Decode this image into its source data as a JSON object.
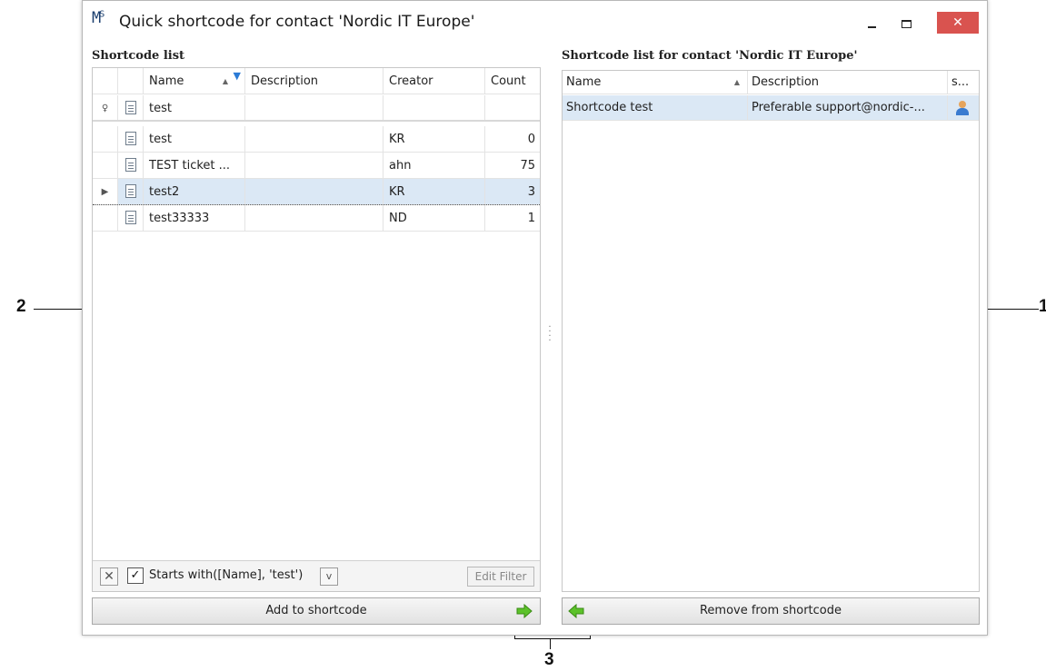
{
  "callouts": {
    "left": "2",
    "right": "1",
    "bottom": "3"
  },
  "window": {
    "logo": "M",
    "logo_sup": "S",
    "title": "Quick shortcode for contact 'Nordic IT Europe'",
    "close_label": "✕"
  },
  "left_panel": {
    "title": "Shortcode list",
    "columns": {
      "name": "Name",
      "description": "Description",
      "creator": "Creator",
      "count": "Count"
    },
    "filter_row": {
      "name": "test"
    },
    "rows": [
      {
        "name": "test",
        "description": "",
        "creator": "KR",
        "count": "0"
      },
      {
        "name": "TEST ticket ...",
        "description": "",
        "creator": "ahn",
        "count": "75"
      },
      {
        "name": "test2",
        "description": "",
        "creator": "KR",
        "count": "3"
      },
      {
        "name": "test33333",
        "description": "",
        "creator": "ND",
        "count": "1"
      }
    ],
    "filter_bar": {
      "clear": "✕",
      "checkbox": "✓",
      "expression": "Starts with([Name], 'test')",
      "dropdown": "v",
      "edit": "Edit Filter"
    },
    "add_button": "Add to shortcode"
  },
  "right_panel": {
    "title": "Shortcode list for contact 'Nordic IT Europe'",
    "columns": {
      "name": "Name",
      "description": "Description",
      "s": "s..."
    },
    "rows": [
      {
        "name": "Shortcode test",
        "description": "Preferable support@nordic-..."
      }
    ],
    "remove_button": "Remove from shortcode"
  },
  "colors": {
    "accent_selection": "#dbe8f5",
    "close_button": "#d9534f",
    "arrow_green": "#5cc22a",
    "filter_icon": "#2b7bd6"
  }
}
